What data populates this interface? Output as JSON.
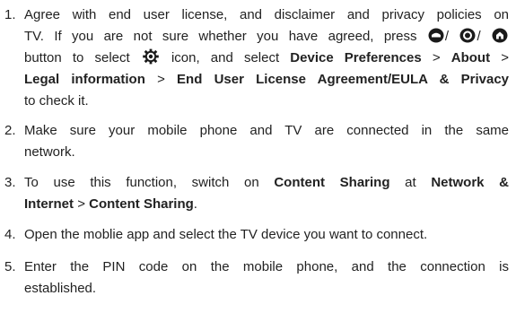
{
  "steps": [
    {
      "number": "1.",
      "line1": "Agree with end user license, and disclaimer and privacy policies on",
      "line2_pre": "TV. If you are not sure whether you have agreed, press",
      "sep1": "/",
      "sep2": "/",
      "line3_pre": "button to select",
      "line3_mid": "icon, and select",
      "device_preferences": "Device Preferences",
      "gt1": ">",
      "about": "About",
      "gt2": ">",
      "legal_information": "Legal information",
      "gt3": ">",
      "eula": "End User License Agreement/EULA & Privacy",
      "line5": "to check it.",
      "icons": [
        "dashboard-button-icon",
        "circle-button-icon",
        "home-button-icon",
        "settings-gear-icon"
      ]
    },
    {
      "number": "2.",
      "line1": "Make sure your mobile phone and TV are connected in the same",
      "line2": "network."
    },
    {
      "number": "3.",
      "line1_pre": "To use this function, switch on",
      "content_sharing": "Content Sharing",
      "at": "at",
      "network_internet_a": "Network &",
      "internet_b": "Internet",
      "gt": ">",
      "content_sharing_2": "Content Sharing",
      "period": "."
    },
    {
      "number": "4.",
      "line1": "Open the moblie app and select the TV device you want to connect."
    },
    {
      "number": "5.",
      "line1": "Enter the PIN code on the mobile phone, and the connection is",
      "line2": "established."
    }
  ],
  "colors": {
    "text": "#222222",
    "icon": "#1a1a1a"
  }
}
